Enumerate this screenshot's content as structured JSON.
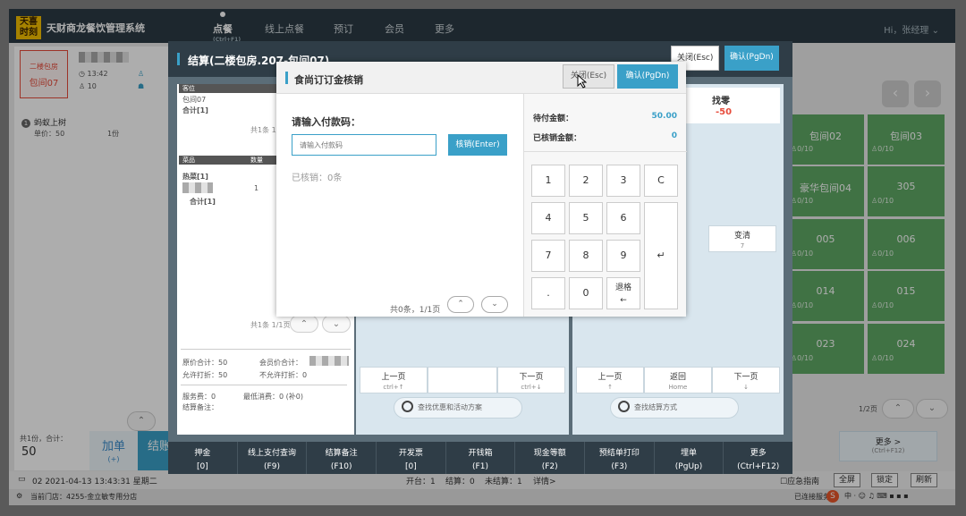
{
  "app": {
    "logo": "天喜时刻",
    "name": "天财商龙餐饮管理系统",
    "user": "Hi，张经理"
  },
  "nav": [
    {
      "label": "点餐",
      "sub": "(Ctrl+F1)"
    },
    {
      "label": "线上点餐"
    },
    {
      "label": "预订"
    },
    {
      "label": "会员"
    },
    {
      "label": "更多"
    }
  ],
  "left": {
    "table_top": "二楼包房",
    "table_name": "包间07",
    "time": "13:42",
    "guests": "10",
    "dish_index": "1",
    "dish_name": "蚂蚁上树",
    "dish_price": "单价：50",
    "dish_qty": "1份",
    "total_label": "共1份，合计：",
    "total_value": "50",
    "add_label": "加单",
    "add_sub": "(+)",
    "settle_label": "结账"
  },
  "right_tables": [
    {
      "name": "包间02",
      "sub": "0/10"
    },
    {
      "name": "包间03",
      "sub": "0/10"
    },
    {
      "name": "豪华包间04",
      "sub": "0/10"
    },
    {
      "name": "305",
      "sub": "0/10"
    },
    {
      "name": "005",
      "sub": "0/10"
    },
    {
      "name": "006",
      "sub": "0/10"
    },
    {
      "name": "014",
      "sub": "0/10"
    },
    {
      "name": "015",
      "sub": "0/10"
    },
    {
      "name": "023",
      "sub": "0/10"
    },
    {
      "name": "024",
      "sub": "0/10"
    }
  ],
  "right_pager": "1/2页",
  "right_more": "更多 >",
  "right_more_sub": "(Ctrl+F12)",
  "settle": {
    "title": "结算(二楼包房.207-包间07)",
    "close": "关闭(Esc)",
    "confirm": "确认(PgDn)",
    "room_header": "客位",
    "room": "包间07",
    "room_total": "合计[1]",
    "count1": "共1条 1/1页",
    "dish_header": "菜品",
    "dish_qty_header": "数量",
    "dish_name": "热菜[1]",
    "dish_qty": "1",
    "dish_amt": "50",
    "dish_total": "合计[1]",
    "count2": "共1条 1/1页",
    "orig_total": "原价合计：50",
    "member_price": "会员价合计：",
    "allow_discount": "允许打折：50",
    "no_discount": "不允许打折：0",
    "service": "服务费：0",
    "min_spend": "最低消费：0 (补0)",
    "settle_note": "结算备注：",
    "change_label": "找零",
    "change_value": "-50",
    "change_mode": "变清",
    "change_mode_sub": "7",
    "mid_prev": "上一页",
    "mid_prev_sub": "ctrl+↑",
    "mid_next": "下一页",
    "mid_next_sub": "ctrl+↓",
    "mid_search": "查找优惠和活动方案",
    "r_prev": "上一页",
    "r_prev_sub": "↑",
    "r_return": "返回",
    "r_return_sub": "Home",
    "r_next": "下一页",
    "r_next_sub": "↓",
    "r_search": "查找结算方式"
  },
  "toolbar": [
    {
      "label": "押金",
      "key": "[0]"
    },
    {
      "label": "线上支付查询",
      "key": "(F9)"
    },
    {
      "label": "结算备注",
      "key": "(F10)"
    },
    {
      "label": "开发票",
      "key": "[0]"
    },
    {
      "label": "开钱箱",
      "key": "(F1)"
    },
    {
      "label": "现金等额",
      "key": "(F2)"
    },
    {
      "label": "预结单打印",
      "key": "(F3)"
    },
    {
      "label": "埋单",
      "key": "(PgUp)"
    },
    {
      "label": "更多",
      "key": "(Ctrl+F12)"
    }
  ],
  "dialog": {
    "title": "食尚订订金核销",
    "close": "关闭(Esc)",
    "confirm": "确认(PgDn)",
    "prompt": "请输入付款码：",
    "placeholder": "请输入付款码",
    "verify": "核销(Enter)",
    "verified": "已核销：0条",
    "pager": "共0条，1/1页",
    "due_label": "待付金额：",
    "due_value": "50.00",
    "done_label": "已核销金额：",
    "done_value": "0",
    "keys": [
      "1",
      "2",
      "3",
      "C",
      "4",
      "5",
      "6",
      "7",
      "8",
      "9",
      "↵",
      ".",
      "0",
      "退格"
    ]
  },
  "status": {
    "terminal": "02 2021-04-13 13:43:31 星期二",
    "open": "开台：1",
    "settled": "结算：0",
    "unsettled": "未结算：1",
    "detail": "详情>",
    "help": "应急指南",
    "full": "全屏",
    "lock": "锁定",
    "refresh": "刷新",
    "store": "当前门店：4255-金立敏专用分店",
    "connected": "已连接服务器"
  }
}
